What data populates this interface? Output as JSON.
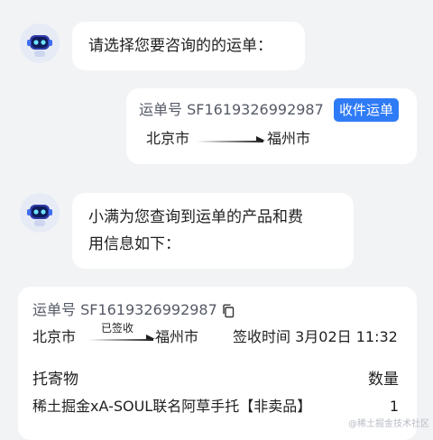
{
  "messages": {
    "bot_prompt": "请选择您要咨询的的运单：",
    "bot_reply_line1": "小满为您查询到运单的产品和费",
    "bot_reply_line2": "用信息如下："
  },
  "waybill_select": {
    "number_label": "运单号 SF1619326992987",
    "button_label": "收件运单",
    "from_city": "北京市",
    "to_city": "福州市"
  },
  "waybill_detail": {
    "number_label": "运单号 SF1619326992987",
    "from_city": "北京市",
    "to_city": "福州市",
    "status": "已签收",
    "sign_time": "签收时间 3月02日 11:32",
    "col_item": "托寄物",
    "col_qty": "数量",
    "item_name": "稀土掘金xA-SOUL联名阿草手托【非卖品】",
    "item_qty": "1"
  },
  "watermark": "@稀土掘金技术社区",
  "colors": {
    "accent": "#2f7bf6",
    "background": "#f2f3f5",
    "avatar_bg": "#e6ebf6"
  },
  "icons": {
    "avatar": "robot-avatar-icon",
    "copy": "copy-icon"
  }
}
